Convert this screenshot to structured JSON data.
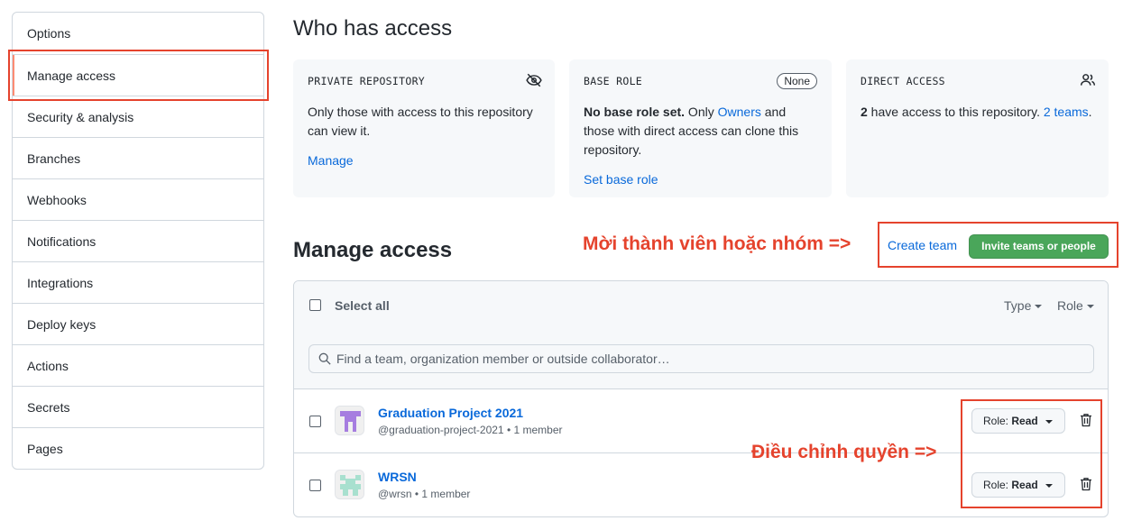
{
  "sidebar": {
    "items": [
      {
        "label": "Options"
      },
      {
        "label": "Manage access",
        "selected": true
      },
      {
        "label": "Security & analysis"
      },
      {
        "label": "Branches"
      },
      {
        "label": "Webhooks"
      },
      {
        "label": "Notifications"
      },
      {
        "label": "Integrations"
      },
      {
        "label": "Deploy keys"
      },
      {
        "label": "Actions"
      },
      {
        "label": "Secrets"
      },
      {
        "label": "Pages"
      }
    ]
  },
  "access": {
    "title": "Who has access",
    "private": {
      "label": "PRIVATE REPOSITORY",
      "text": "Only those with access to this repository can view it.",
      "link": "Manage",
      "icon": "eye-closed-icon"
    },
    "base_role": {
      "label": "BASE ROLE",
      "pill": "None",
      "bold": "No base role set.",
      "text_before_link": " Only ",
      "link_inline": "Owners",
      "text_after_link": " and those with direct access can clone this repository.",
      "link": "Set base role"
    },
    "direct": {
      "label": "DIRECT ACCESS",
      "count": "2",
      "text": " have access to this repository. ",
      "link": "2 teams",
      "suffix": ".",
      "icon": "people-icon"
    }
  },
  "manage": {
    "title": "Manage access",
    "annotation_invite": "Mời thành viên hoặc nhóm =>",
    "annotation_role": "Điều chỉnh quyền =>",
    "create_team": "Create team",
    "invite_button": "Invite teams or people",
    "select_all": "Select all",
    "filter_type": "Type",
    "filter_role": "Role",
    "search_placeholder": "Find a team, organization member or outside collaborator…",
    "rows": [
      {
        "name": "Graduation Project 2021",
        "handle": "@graduation-project-2021",
        "members": "1 member",
        "role_prefix": "Role: ",
        "role": "Read"
      },
      {
        "name": "WRSN",
        "handle": "@wrsn",
        "members": "1 member",
        "role_prefix": "Role: ",
        "role": "Read"
      }
    ]
  },
  "colors": {
    "accent_link": "#0969da",
    "invite_green": "#4aa65a",
    "annotation_red": "#e5432d",
    "avatar_purple": "#a67de0",
    "avatar_mint": "#a8e0cf"
  }
}
